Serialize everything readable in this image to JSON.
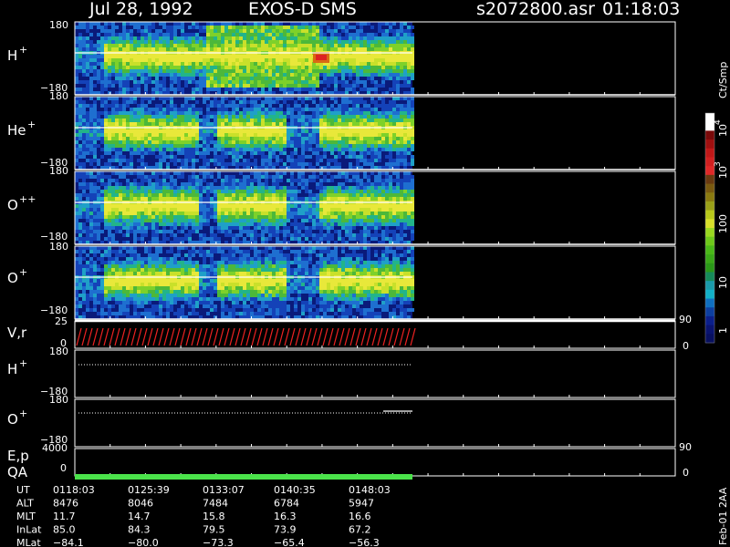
{
  "header": {
    "date": "Jul 28, 1992",
    "instrument": "EXOS-D SMS",
    "filename": "s2072800.asr",
    "time": "01:18:03"
  },
  "panels": [
    {
      "id": "hplus",
      "label": "H",
      "sup": "+",
      "top": "180",
      "bottom": "−180"
    },
    {
      "id": "heplus",
      "label": "He",
      "sup": "+",
      "top": "180",
      "bottom": "−180"
    },
    {
      "id": "oplusplus",
      "label": "O",
      "sup": "++",
      "top": "180",
      "bottom": "−180"
    },
    {
      "id": "oplus",
      "label": "O",
      "sup": "+",
      "top": "180",
      "bottom": "−180"
    }
  ],
  "vr_panel": {
    "label": "V,r",
    "top": "25",
    "bottom": "0",
    "right_top": "90",
    "right_bottom": "0"
  },
  "line_panels": [
    {
      "id": "hplus2",
      "label": "H",
      "sup": "+",
      "top": "180",
      "bottom": "−180"
    },
    {
      "id": "oplus2",
      "label": "O",
      "sup": "+",
      "top": "180",
      "bottom": "−180"
    }
  ],
  "ep_panel": {
    "label": "E,p",
    "top": "4000",
    "bottom": "0",
    "right_top": "90",
    "right_bottom": "0",
    "qa_label": "QA"
  },
  "colorbar": {
    "unit": "Ct/Smp",
    "ticks": [
      "10",
      "3",
      "10",
      "100",
      "10",
      "1"
    ],
    "tick_labels": {
      "t4": "10",
      "t4_exp": "4",
      "t3": "10",
      "t3_exp": "3",
      "t100": "100",
      "t10": "10",
      "t1": "1"
    }
  },
  "footer_rows": [
    {
      "name": "UT",
      "values": [
        "0118:03",
        "0125:39",
        "0133:07",
        "0140:35",
        "0148:03"
      ]
    },
    {
      "name": "ALT",
      "values": [
        "8476",
        "8046",
        "7484",
        "6784",
        "5947"
      ]
    },
    {
      "name": "MLT",
      "values": [
        "11.7",
        "14.7",
        "15.8",
        "16.3",
        "16.6"
      ]
    },
    {
      "name": "InLat",
      "values": [
        "85.0",
        "84.3",
        "79.5",
        "73.9",
        "67.2"
      ]
    },
    {
      "name": "MLat",
      "values": [
        "−84.1",
        "−80.0",
        "−73.3",
        "−65.4",
        "−56.3"
      ]
    }
  ],
  "side_note": "Feb-01 2AA",
  "chart_data": {
    "type": "heatmap",
    "title": "Jul 28, 1992  EXOS-D SMS",
    "x_label": "UT",
    "x_ticks": [
      "0118:03",
      "0125:39",
      "0133:07",
      "0140:35",
      "0148:03"
    ],
    "y_range": [
      -180,
      180
    ],
    "color_scale": "log",
    "color_range": [
      1,
      10000
    ],
    "series": [
      {
        "name": "H+",
        "y_range": [
          -180,
          180
        ]
      },
      {
        "name": "He+",
        "y_range": [
          -180,
          180
        ]
      },
      {
        "name": "O++",
        "y_range": [
          -180,
          180
        ]
      },
      {
        "name": "O+",
        "y_range": [
          -180,
          180
        ]
      }
    ]
  }
}
